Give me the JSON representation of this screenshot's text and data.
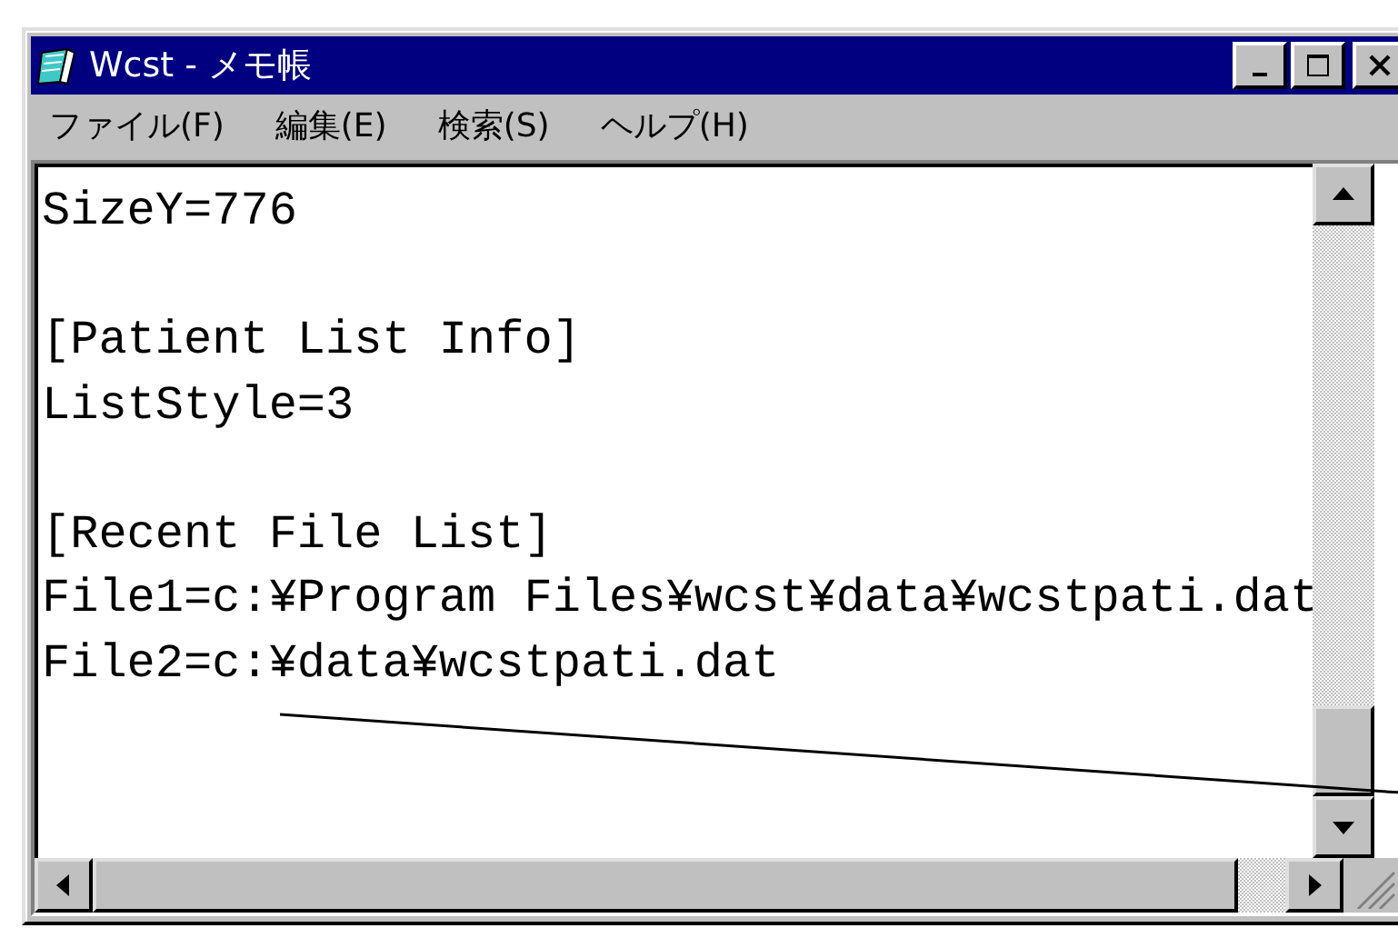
{
  "window": {
    "title": "Wcst - メモ帳"
  },
  "menu": [
    "ファイル(F)",
    "編集(E)",
    "検索(S)",
    "ヘルプ(H)"
  ],
  "document": {
    "paragraphs": [
      [
        "SizeY=776"
      ],
      [
        "[Patient List Info]",
        "ListStyle=3"
      ],
      [
        "[Recent File List]",
        "File1=c:¥Program Files¥wcst¥data¥wcstpati.dat",
        "File2=c:¥data¥wcstpati.dat"
      ]
    ]
  }
}
